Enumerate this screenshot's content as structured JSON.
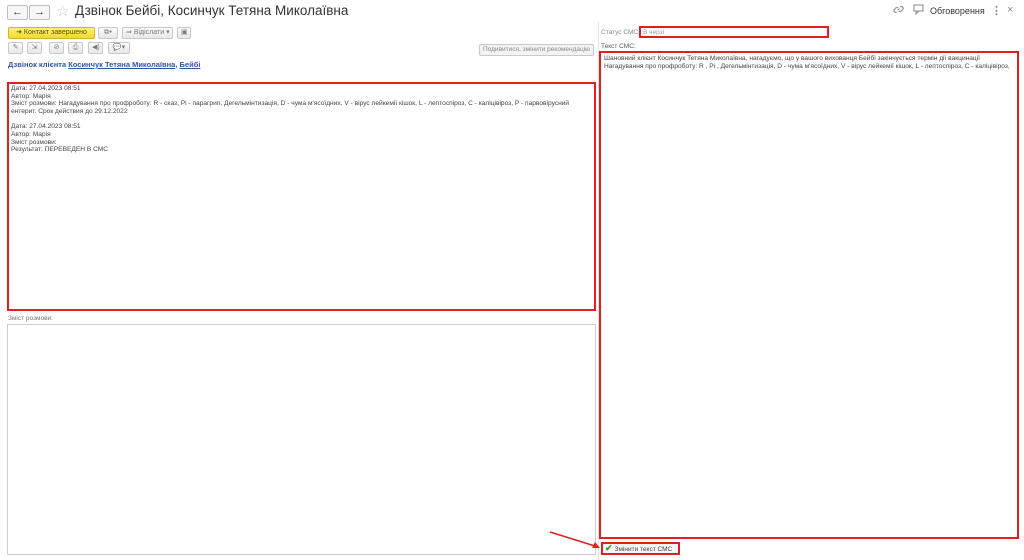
{
  "window": {
    "title": "Дзвінок Бейбі, Косинчук Тетяна Миколаївна",
    "discussions_label": "Обговорення"
  },
  "icons": {
    "back": "arrow-left-icon",
    "forward": "arrow-right-icon",
    "favorite": "star-icon",
    "link": "link-icon",
    "chat": "chat-icon",
    "more": "more-vertical-icon",
    "close": "close-icon"
  },
  "toolbar": {
    "contact_completed": "Контакт завершено",
    "send_label": "Відіслати",
    "recommend_label": "Подивитися, змінити рекомендацію"
  },
  "client": {
    "prefix": "Дзвінок клієнта",
    "name": "Косинчук Тетяна Миколаївна",
    "pet": "Бейбі"
  },
  "history": {
    "entries": [
      {
        "date": "Дата: 27.04.2023 08:51",
        "author": "Автор: Марія",
        "content": "Зміст розмови: Нагадування про профроботу: R - сказ, Pi - парагрип, Дегельмінтизація, D - чума м'ясоїдних, V - вірус лейкемії кішок, L - лептоспіроз, C - каліцівіроз, P - парвовірусний ентерит. Срок действия до 29.12.2022"
      },
      {
        "date": "Дата: 27.04.2023 08:51",
        "author": "Автор: Марія",
        "content": "Зміст розмови:",
        "result": "Результат: ПЕРЕВЕДЕН В СМС"
      }
    ]
  },
  "conversation": {
    "label": "Зміст розмови:",
    "value": ""
  },
  "sms": {
    "status_label": "Статус СМС:",
    "status_value": "В черзі",
    "text_label": "Текст СМС:",
    "text_value": "Шановний клієнт Косинчук Тетяна Миколаївна, нагадуємо, що у вашого вихованця Бейбі закінчується термін дії вакцинації Нагадування про профроботу: R , Pi , Дегельмінтизація, D - чума м'ясоїдних, V - вірус лейкемії кішок, L - лептоспіроз, C - каліцівіроз,",
    "change_button": "Змінити текст СМС"
  },
  "colors": {
    "highlight": "#e0201e",
    "accent_yellow": "#f2d92c",
    "link_blue": "#3554a8"
  }
}
